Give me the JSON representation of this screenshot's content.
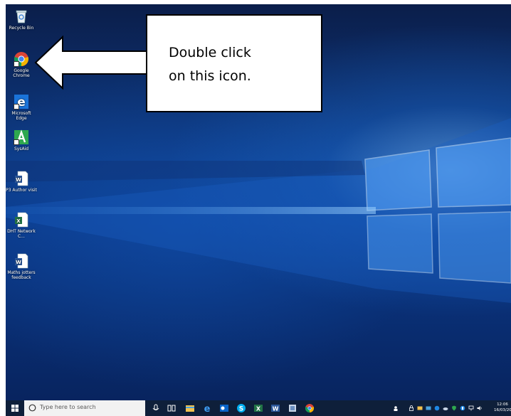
{
  "desktop": {
    "icons": [
      {
        "label": "Recycle Bin",
        "icon": "recycle-bin-icon"
      },
      {
        "label": "Google Chrome",
        "icon": "chrome-icon"
      },
      {
        "label": "Microsoft Edge",
        "icon": "edge-icon"
      },
      {
        "label": "SysAid",
        "icon": "sysaid-icon"
      },
      {
        "label": "P3 Author visit",
        "icon": "word-document-icon"
      },
      {
        "label": "DHT Network C...",
        "icon": "excel-document-icon"
      },
      {
        "label": "Maths jotters feedback",
        "icon": "word-document-icon"
      }
    ]
  },
  "callout": {
    "text": "Double click\non this icon."
  },
  "taskbar": {
    "search_placeholder": "Type here to search",
    "pinned": [
      "cortana-mic-icon",
      "task-view-icon",
      "file-explorer-icon",
      "edge-icon",
      "outlook-icon",
      "skype-icon",
      "excel-icon",
      "word-icon",
      "files-icon",
      "chrome-icon"
    ],
    "clock_time": "12:06",
    "clock_date": "16/03/20"
  },
  "colors": {
    "taskbar": "#0e1f3a",
    "accent": "#1e6fd9"
  }
}
